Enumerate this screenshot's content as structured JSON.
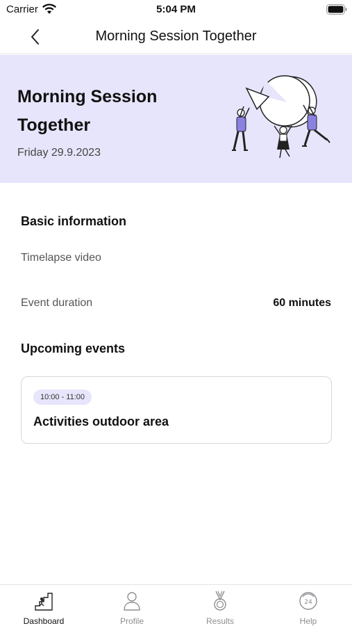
{
  "status_bar": {
    "carrier": "Carrier",
    "time": "5:04 PM",
    "wifi_icon": "wifi-icon",
    "battery_icon": "battery-icon"
  },
  "nav": {
    "back_icon": "chevron-left-icon",
    "title": "Morning Session Together"
  },
  "hero": {
    "title": "Morning Session Together",
    "date": "Friday 29.9.2023",
    "background_color": "#e7e5fb",
    "accent_color": "#8b82e0",
    "illustration": "people-lifting-pie-chart"
  },
  "basic_info": {
    "heading": "Basic information",
    "timelapse_label": "Timelapse video",
    "duration_label": "Event duration",
    "duration_value": "60 minutes"
  },
  "upcoming": {
    "heading": "Upcoming events",
    "events": [
      {
        "time": "10:00 - 11:00",
        "title": "Activities outdoor area"
      }
    ]
  },
  "tab_bar": {
    "tabs": [
      {
        "label": "Dashboard",
        "icon": "stairs-icon",
        "active": true
      },
      {
        "label": "Profile",
        "icon": "user-icon",
        "active": false
      },
      {
        "label": "Results",
        "icon": "medal-icon",
        "active": false
      },
      {
        "label": "Help",
        "icon": "support-24h-icon",
        "active": false
      }
    ]
  }
}
